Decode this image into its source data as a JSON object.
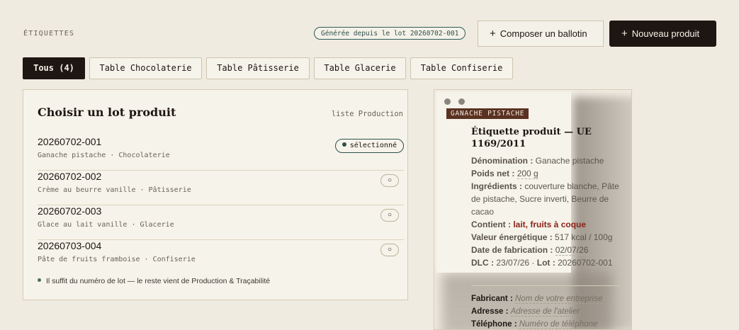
{
  "header": {
    "section_title": "ÉTIQUETTES",
    "lot_badge": "Générée depuis le lot 20260702-001",
    "compose_button": "Composer un ballotin",
    "new_product_button": "Nouveau produit",
    "plus_glyph": "+"
  },
  "tabs": [
    {
      "label": "Tous (4)",
      "active": true
    },
    {
      "label": "Table Chocolaterie",
      "active": false
    },
    {
      "label": "Table Pâtisserie",
      "active": false
    },
    {
      "label": "Table Glacerie",
      "active": false
    },
    {
      "label": "Table Confiserie",
      "active": false
    }
  ],
  "lot_panel": {
    "title": "Choisir un lot produit",
    "subtitle": "liste Production",
    "selected_label": "sélectionné",
    "unselected_glyph": "○",
    "lots": [
      {
        "number": "20260702-001",
        "description": "Ganache pistache · Chocolaterie",
        "selected": true
      },
      {
        "number": "20260702-002",
        "description": "Crème au beurre vanille · Pâtisserie",
        "selected": false
      },
      {
        "number": "20260702-003",
        "description": "Glace au lait vanille · Glacerie",
        "selected": false
      },
      {
        "number": "20260703-004",
        "description": "Pâte de fruits framboise · Confiserie",
        "selected": false
      }
    ],
    "footnote": "Il suffit du numéro de lot — le reste vient de Production & Traçabilité"
  },
  "label_preview": {
    "tag": "GANACHE PISTACHE",
    "title": "Étiquette produit — UE 1169/2011",
    "denomination_label": "Dénomination :",
    "denomination_value": "Ganache pistache",
    "weight_label": "Poids net :",
    "weight_value": "200 g",
    "ingredients_label": "Ingrédients :",
    "ingredients_value": "couverture blanche, Pâte de pistache, Sucre inverti, Beurre de cacao",
    "contains_label": "Contient :",
    "contains_value": "lait, fruits à coque",
    "energy_label": "Valeur énergétique :",
    "energy_value": "517 kcal / 100g",
    "fab_date_label": "Date de fabrication :",
    "fab_date_value": "02/07/26",
    "dlc_label": "DLC :",
    "dlc_value": "23/07/26",
    "lot_label": "Lot :",
    "lot_value": "20260702-001",
    "maker_label": "Fabricant :",
    "maker_placeholder": "Nom de votre entreprise",
    "address_label": "Adresse :",
    "address_placeholder": "Adresse de l'atelier",
    "phone_label": "Téléphone :",
    "phone_placeholder": "Numéro de téléphone"
  },
  "colors": {
    "background": "#efebe1",
    "dark": "#1e1612",
    "accent_teal": "#2f4f4c",
    "tag_brown": "#5a3222",
    "allergen_red": "#8b2318"
  }
}
